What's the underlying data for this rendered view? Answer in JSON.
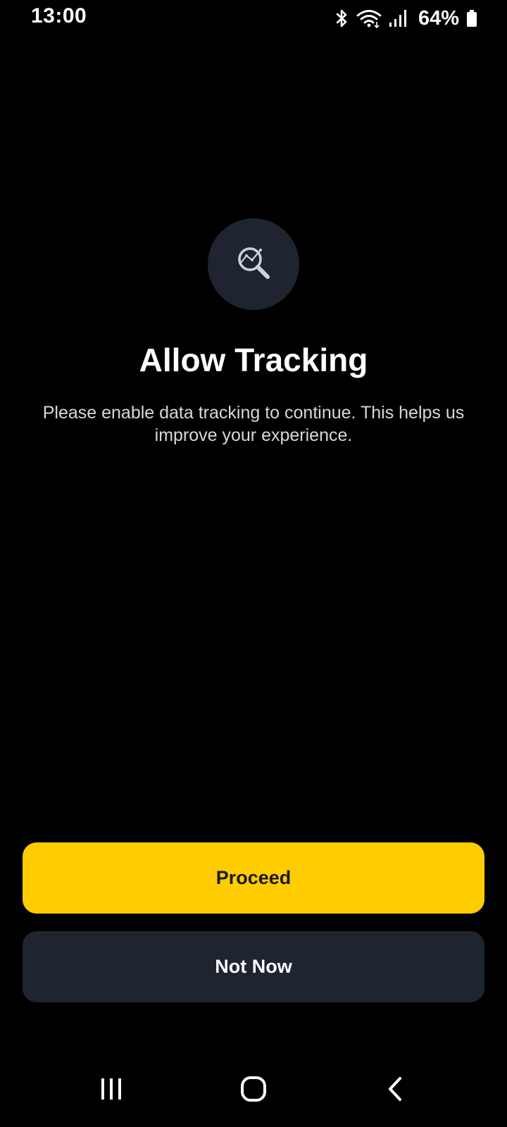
{
  "status_bar": {
    "time": "13:00",
    "battery_percent": "64%",
    "icons": [
      "bluetooth-icon",
      "wifi-icon",
      "signal-icon",
      "battery-icon"
    ]
  },
  "prompt": {
    "icon": "analytics-search-icon",
    "title": "Allow Tracking",
    "description": "Please enable data tracking to continue. This helps us improve your experience."
  },
  "actions": {
    "proceed_label": "Proceed",
    "not_now_label": "Not Now"
  },
  "navigation": {
    "icons": [
      "recents-icon",
      "home-icon",
      "back-icon"
    ]
  },
  "colors": {
    "background": "#000000",
    "accent": "#ffcc00",
    "surface": "#1e2530",
    "text_primary": "#ffffff"
  }
}
